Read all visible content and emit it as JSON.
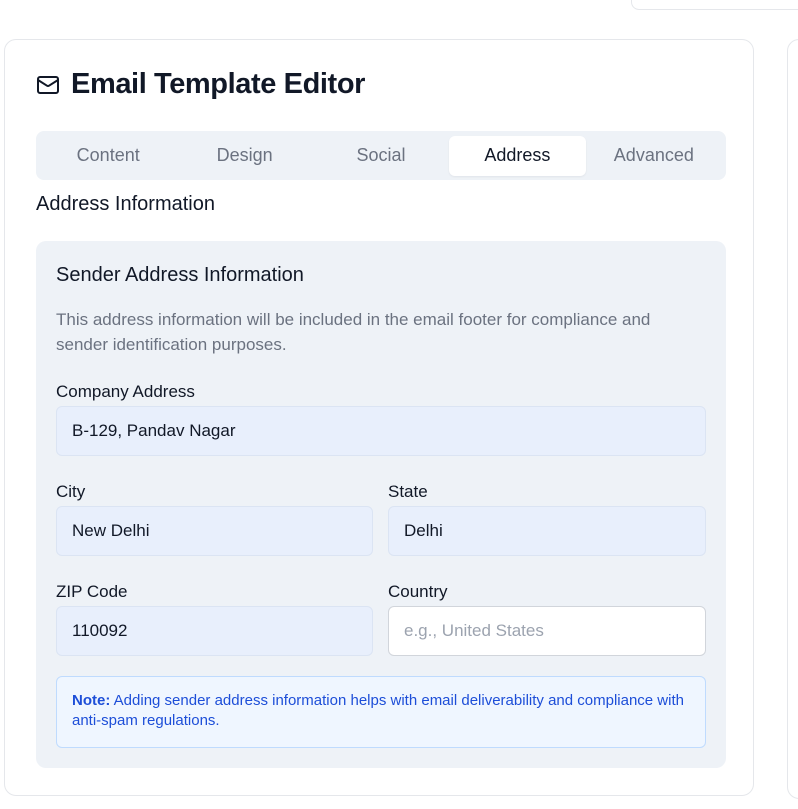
{
  "editor": {
    "title": "Email Template Editor",
    "icon": "mail-icon"
  },
  "tabs": [
    {
      "label": "Content",
      "active": false
    },
    {
      "label": "Design",
      "active": false
    },
    {
      "label": "Social",
      "active": false
    },
    {
      "label": "Address",
      "active": true
    },
    {
      "label": "Advanced",
      "active": false
    }
  ],
  "section": {
    "title": "Address Information"
  },
  "sender": {
    "title": "Sender Address Information",
    "description": "This address information will be included in the email footer for compliance and sender identification purposes.",
    "company_address": {
      "label": "Company Address",
      "value": "B-129, Pandav Nagar"
    },
    "city": {
      "label": "City",
      "value": "New Delhi"
    },
    "state": {
      "label": "State",
      "value": "Delhi"
    },
    "zip": {
      "label": "ZIP Code",
      "value": "110092"
    },
    "country": {
      "label": "Country",
      "value": "",
      "placeholder": "e.g., United States"
    },
    "note": {
      "prefix": "Note:",
      "text": "Adding sender address information helps with email deliverability and compliance with anti-spam regulations."
    }
  },
  "colors": {
    "accent_blue": "#1d4ed8",
    "filled_input_bg": "#e8effc",
    "panel_bg": "#eef2f7"
  }
}
